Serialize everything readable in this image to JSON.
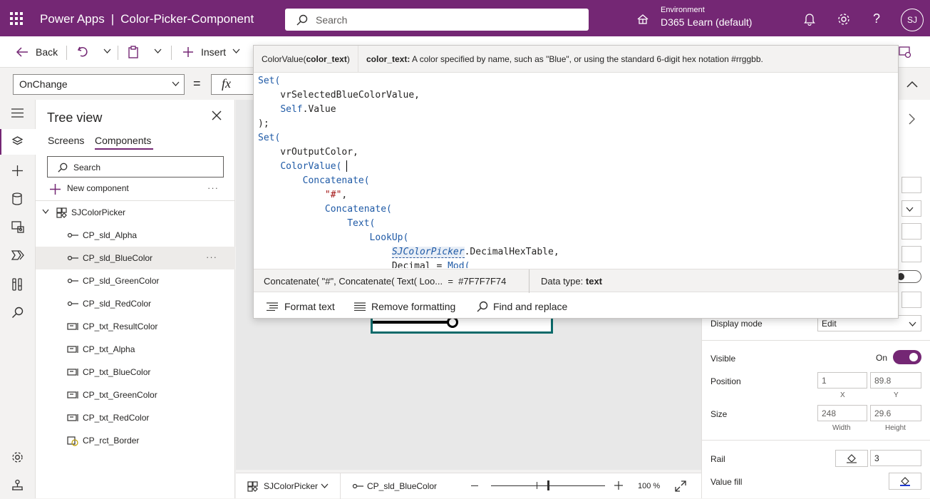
{
  "app": {
    "product": "Power Apps",
    "separator": "|",
    "title": "Color-Picker-Component"
  },
  "search": {
    "placeholder": "Search"
  },
  "environment": {
    "label": "Environment",
    "name": "D365 Learn (default)"
  },
  "user": {
    "initials": "SJ"
  },
  "toolbar": {
    "back_label": "Back",
    "insert_label": "Insert"
  },
  "formula_bar": {
    "property": "OnChange",
    "equals": "=",
    "fx": "fx"
  },
  "tree": {
    "title": "Tree view",
    "tabs": [
      "Screens",
      "Components"
    ],
    "active_tab": "Components",
    "search_placeholder": "Search",
    "new_component_label": "New component",
    "more": "···",
    "component": "SJColorPicker",
    "items": [
      {
        "label": "CP_sld_Alpha",
        "icon": "slider-icon"
      },
      {
        "label": "CP_sld_BlueColor",
        "icon": "slider-icon",
        "selected": true
      },
      {
        "label": "CP_sld_GreenColor",
        "icon": "slider-icon"
      },
      {
        "label": "CP_sld_RedColor",
        "icon": "slider-icon"
      },
      {
        "label": "CP_txt_ResultColor",
        "icon": "textinput-icon"
      },
      {
        "label": "CP_txt_Alpha",
        "icon": "textinput-icon"
      },
      {
        "label": "CP_txt_BlueColor",
        "icon": "textinput-icon"
      },
      {
        "label": "CP_txt_GreenColor",
        "icon": "textinput-icon"
      },
      {
        "label": "CP_txt_RedColor",
        "icon": "textinput-icon"
      },
      {
        "label": "CP_rct_Border",
        "icon": "rectangle-icon"
      }
    ]
  },
  "intellisense": {
    "signature_fn": "ColorValue(",
    "signature_param": "color_text",
    "signature_close": ")",
    "param_name": "color_text:",
    "param_desc": "A color specified by name, such as \"Blue\", or using the standard 6-digit hex notation #rrggbb."
  },
  "code_lines": [
    [
      {
        "t": "Set(",
        "c": "kw"
      }
    ],
    [
      {
        "t": "    vrSelectedBlueColorValue,",
        "c": ""
      }
    ],
    [
      {
        "t": "    ",
        "c": ""
      },
      {
        "t": "Self",
        "c": "kw"
      },
      {
        "t": ".Value",
        "c": ""
      }
    ],
    [
      {
        "t": ");",
        "c": ""
      }
    ],
    [
      {
        "t": "Set(",
        "c": "kw"
      }
    ],
    [
      {
        "t": "    vrOutputColor,",
        "c": ""
      }
    ],
    [
      {
        "t": "    ",
        "c": ""
      },
      {
        "t": "ColorValue(",
        "c": "kw"
      }
    ],
    [
      {
        "t": "        ",
        "c": ""
      },
      {
        "t": "Concatenate(",
        "c": "kw"
      }
    ],
    [
      {
        "t": "            ",
        "c": ""
      },
      {
        "t": "\"#\"",
        "c": "str"
      },
      {
        "t": ",",
        "c": ""
      }
    ],
    [
      {
        "t": "            ",
        "c": ""
      },
      {
        "t": "Concatenate(",
        "c": "kw"
      }
    ],
    [
      {
        "t": "                ",
        "c": ""
      },
      {
        "t": "Text(",
        "c": "kw"
      }
    ],
    [
      {
        "t": "                    ",
        "c": ""
      },
      {
        "t": "LookUp(",
        "c": "kw"
      }
    ],
    [
      {
        "t": "                        ",
        "c": ""
      },
      {
        "t": "SJColorPicker",
        "c": "ref"
      },
      {
        "t": ".DecimalHexTable,",
        "c": ""
      }
    ],
    [
      {
        "t": "                        Decimal = ",
        "c": ""
      },
      {
        "t": "Mod(",
        "c": "kw"
      }
    ]
  ],
  "preview": {
    "expression": "Concatenate( \"#\", Concatenate( Text( Loo...",
    "equals": "=",
    "value": "#7F7F7F74",
    "type_label": "Data type:",
    "type_value": "text"
  },
  "format_bar": {
    "format_text": "Format text",
    "remove_formatting": "Remove formatting",
    "find_replace": "Find and replace"
  },
  "properties": {
    "display_mode_label": "Display mode",
    "display_mode_value": "Edit",
    "visible_label": "Visible",
    "visible_value": "On",
    "visible_on": true,
    "position_label": "Position",
    "x": "1",
    "y": "89.8",
    "x_label": "X",
    "y_label": "Y",
    "size_label": "Size",
    "width": "248",
    "height": "29.6",
    "width_label": "Width",
    "height_label": "Height",
    "rail_label": "Rail",
    "rail_value": "3",
    "value_fill_label": "Value fill",
    "value_fill_color": "#1f3ad1"
  },
  "status_bar": {
    "component": "SJColorPicker",
    "control": "CP_sld_BlueColor",
    "zoom": "100 %",
    "zoom_level": 0.5
  },
  "colors": {
    "brand": "#742774",
    "accent_teal": "#0b6a6a"
  }
}
